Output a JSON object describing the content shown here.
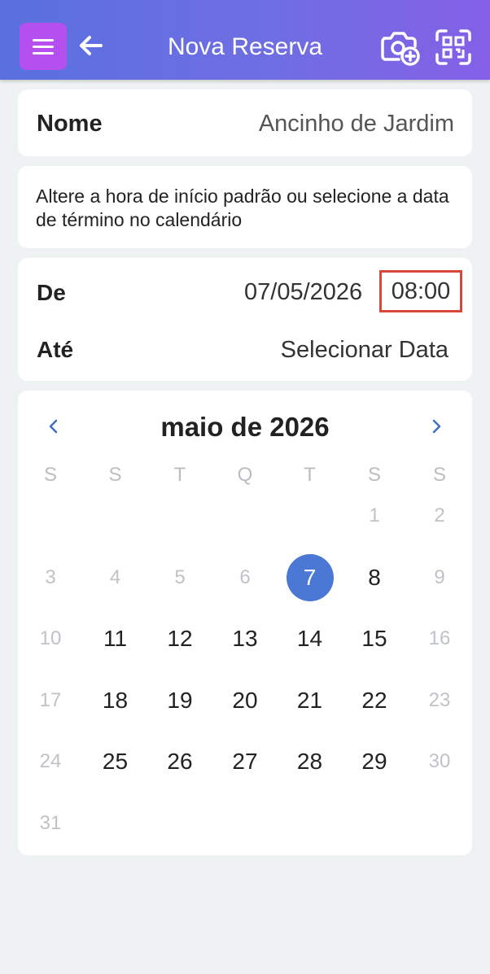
{
  "header": {
    "title": "Nova Reserva",
    "menu_icon": "hamburger-menu-icon",
    "back_icon": "arrow-left-icon",
    "camera_icon": "camera-add-icon",
    "scan_icon": "qr-scan-icon",
    "accent_color": "#b54ff0",
    "gradient": [
      "#5a70de",
      "#8460e6"
    ]
  },
  "item": {
    "label": "Nome",
    "value": "Ancinho de Jardim"
  },
  "info": {
    "text": "Altere a hora de início padrão ou selecione a data de término no calendário"
  },
  "range": {
    "from_label": "De",
    "from_date": "07/05/2026",
    "from_time": "08:00",
    "to_label": "Até",
    "to_value": "Selecionar Data",
    "highlight_color": "#d9463a"
  },
  "calendar": {
    "month_label": "maio de 2026",
    "weekdays": [
      "S",
      "S",
      "T",
      "Q",
      "T",
      "S",
      "S"
    ],
    "selected_day": 7,
    "selected_color": "#4a78d4",
    "weeks": [
      [
        null,
        null,
        null,
        null,
        null,
        {
          "d": "1",
          "muted": true
        },
        {
          "d": "2",
          "muted": true
        }
      ],
      [
        {
          "d": "3",
          "muted": true
        },
        {
          "d": "4",
          "muted": true
        },
        {
          "d": "5",
          "muted": true
        },
        {
          "d": "6",
          "muted": true
        },
        {
          "d": "7",
          "selected": true
        },
        {
          "d": "8"
        },
        {
          "d": "9",
          "muted": true
        }
      ],
      [
        {
          "d": "10",
          "muted": true
        },
        {
          "d": "11"
        },
        {
          "d": "12"
        },
        {
          "d": "13"
        },
        {
          "d": "14"
        },
        {
          "d": "15"
        },
        {
          "d": "16",
          "muted": true
        }
      ],
      [
        {
          "d": "17",
          "muted": true
        },
        {
          "d": "18"
        },
        {
          "d": "19"
        },
        {
          "d": "20"
        },
        {
          "d": "21"
        },
        {
          "d": "22"
        },
        {
          "d": "23",
          "muted": true
        }
      ],
      [
        {
          "d": "24",
          "muted": true
        },
        {
          "d": "25"
        },
        {
          "d": "26"
        },
        {
          "d": "27"
        },
        {
          "d": "28"
        },
        {
          "d": "29"
        },
        {
          "d": "30",
          "muted": true
        }
      ],
      [
        {
          "d": "31",
          "muted": true
        },
        null,
        null,
        null,
        null,
        null,
        null
      ]
    ]
  }
}
